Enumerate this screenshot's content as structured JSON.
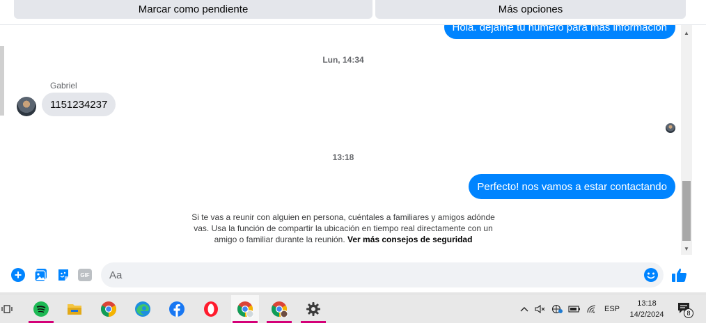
{
  "actions": {
    "mark_pending": "Marcar como pendiente",
    "more_options": "Más opciones"
  },
  "thread": {
    "messages": [
      {
        "direction": "outgoing",
        "text": "Hola. dejame tu numero para mas informacion"
      },
      {
        "direction": "timestamp",
        "text": "Lun, 14:34"
      },
      {
        "direction": "incoming",
        "sender": "Gabriel",
        "text": "1151234237"
      },
      {
        "direction": "timestamp",
        "text": "13:18"
      },
      {
        "direction": "outgoing",
        "text": "Perfecto! nos vamos a estar contactando"
      }
    ],
    "safety_notice": "Si te vas a reunir con alguien en persona, cuéntales a familiares y amigos adónde vas. Usa la función de compartir la ubicación en tiempo real directamente con un amigo o familiar durante la reunión.",
    "safety_link": "Ver más consejos de seguridad"
  },
  "composer": {
    "placeholder": "Aa",
    "gif_label": "GIF",
    "accent": "#0084ff"
  },
  "taskbar": {
    "apps": [
      "task-view",
      "spotify",
      "file-explorer",
      "chrome",
      "edge",
      "facebook",
      "opera",
      "chrome-profile",
      "chrome-profile-2",
      "settings"
    ],
    "language": "ESP",
    "time": "13:18",
    "date": "14/2/2024",
    "notification_count": "8"
  }
}
